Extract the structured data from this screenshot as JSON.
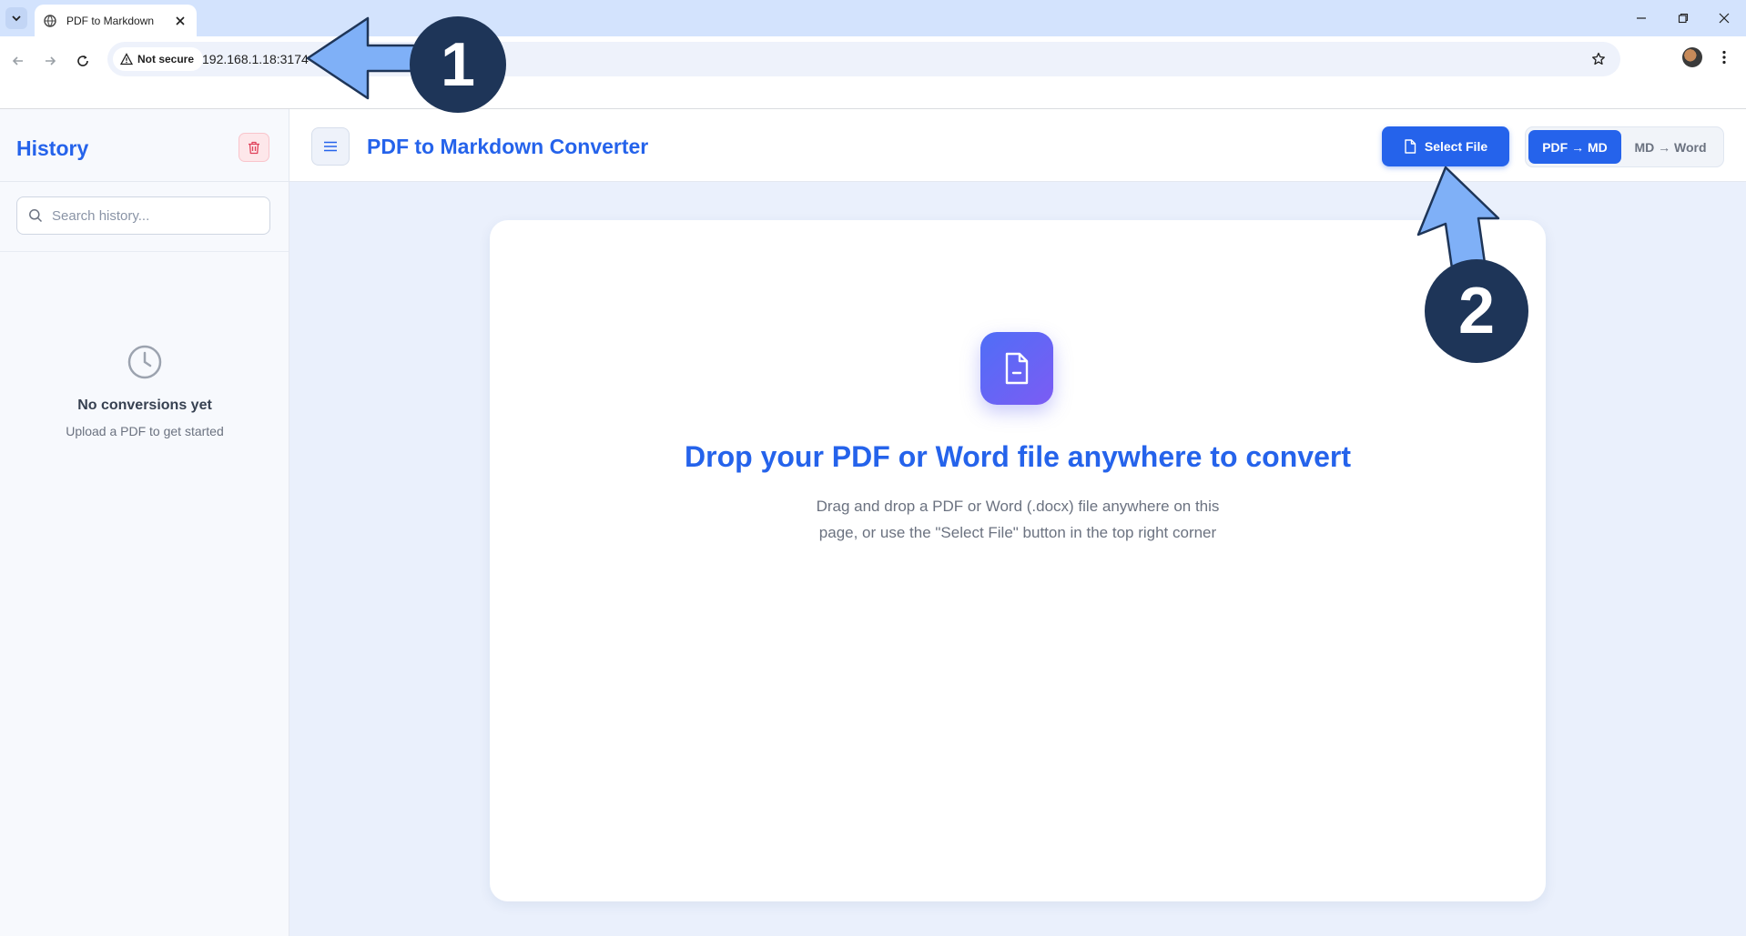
{
  "browser": {
    "tab_title": "PDF to Markdown",
    "security_label": "Not secure",
    "url": "192.168.1.18:3174"
  },
  "sidebar": {
    "title": "History",
    "search_placeholder": "Search history...",
    "empty_title": "No conversions yet",
    "empty_subtitle": "Upload a PDF to get started"
  },
  "header": {
    "title": "PDF to Markdown Converter",
    "select_file_label": "Select File",
    "modes": [
      "PDF → MD",
      "MD → Word"
    ],
    "active_mode": "PDF → MD"
  },
  "dropzone": {
    "title": "Drop your PDF or Word file anywhere to convert",
    "description": "Drag and drop a PDF or Word (.docx) file anywhere on this page, or use the \"Select File\" button in the top right corner"
  },
  "annotations": {
    "step1": "1",
    "step2": "2"
  },
  "colors": {
    "accent": "#2563eb",
    "annotation_arrow": "#7fb0f7",
    "annotation_circle": "#1e3558"
  }
}
